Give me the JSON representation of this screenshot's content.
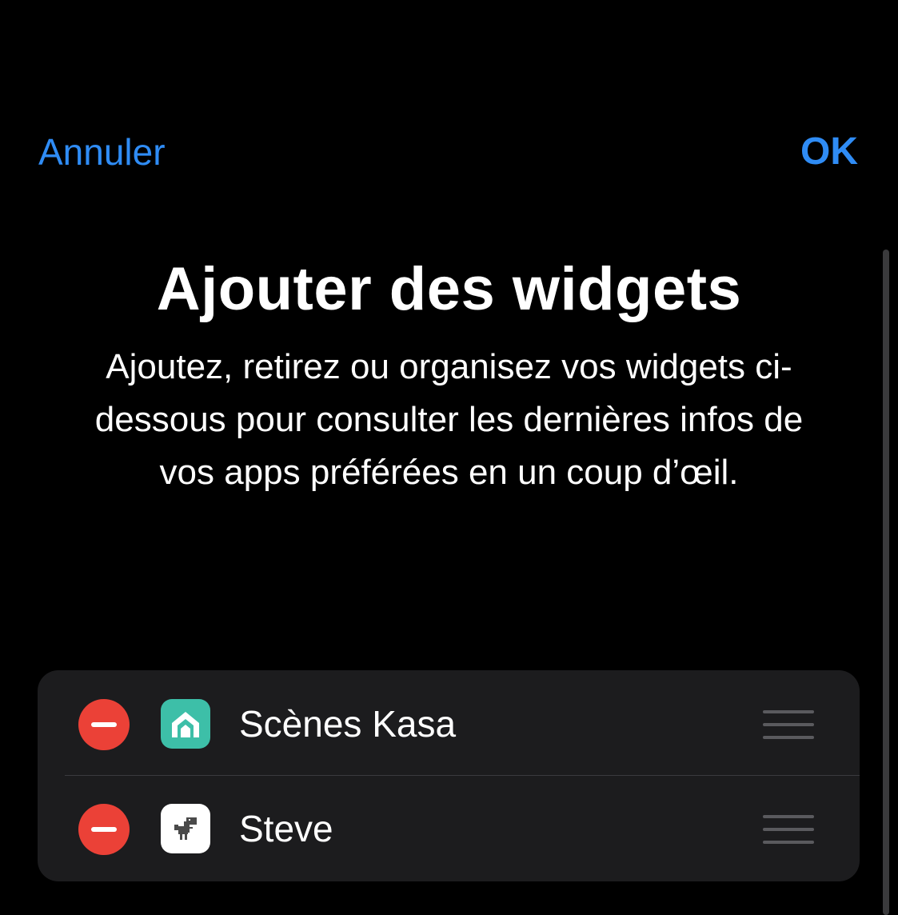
{
  "nav": {
    "cancel_label": "Annuler",
    "ok_label": "OK"
  },
  "header": {
    "title": "Ajouter des widgets",
    "description": "Ajoutez, retirez ou organisez vos widgets ci-dessous pour consulter les dernières infos de vos apps préférées en un coup d’œil."
  },
  "widgets": [
    {
      "name": "Scènes Kasa",
      "icon": "kasa-app-icon",
      "icon_color": "#3dbfa8"
    },
    {
      "name": "Steve",
      "icon": "dinosaur-app-icon",
      "icon_color": "#ffffff"
    }
  ],
  "colors": {
    "accent": "#2f8cf5",
    "remove": "#eb4137",
    "background": "#000000",
    "card": "#1c1c1e"
  }
}
